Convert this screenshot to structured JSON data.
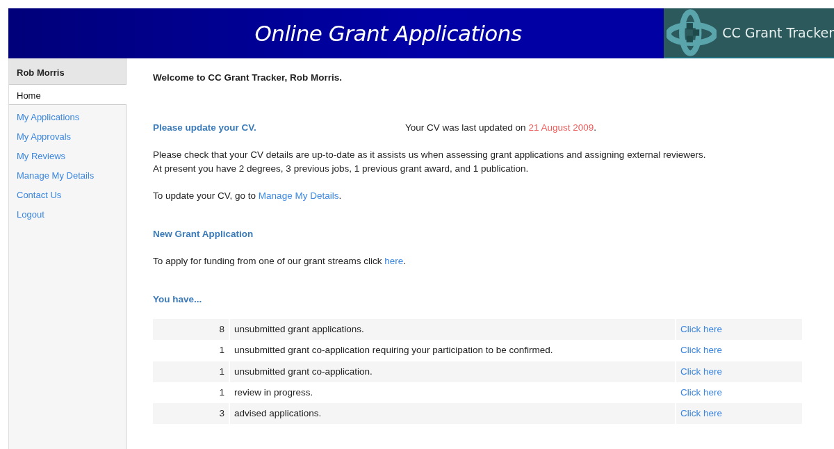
{
  "header": {
    "title": "Online Grant Applications",
    "brand": "CC Grant Tracker"
  },
  "sidebar": {
    "user": "Rob Morris",
    "items": [
      {
        "label": "Home",
        "selected": true
      },
      {
        "label": "My Applications",
        "selected": false
      },
      {
        "label": "My Approvals",
        "selected": false
      },
      {
        "label": "My Reviews",
        "selected": false
      },
      {
        "label": "Manage My Details",
        "selected": false
      },
      {
        "label": "Contact Us",
        "selected": false
      },
      {
        "label": "Logout",
        "selected": false
      }
    ]
  },
  "welcome": "Welcome to CC Grant Tracker, Rob Morris.",
  "cv": {
    "heading": "Please update your CV.",
    "last_updated": [
      {
        "kind": "plain",
        "text": "Your CV was last updated on "
      },
      {
        "kind": "date",
        "text": "21 August 2009"
      },
      {
        "kind": "plain",
        "text": "."
      }
    ],
    "paragraphs": [
      [
        {
          "kind": "plain",
          "text": "Please check that your CV details are up-to-date as it assists us when assessing grant applications and assigning external reviewers."
        }
      ],
      [
        {
          "kind": "plain",
          "text": "At present you have 2 degrees, 3 previous jobs, 1 previous grant award, and 1 publication."
        }
      ],
      [
        {
          "kind": "plain",
          "text": "To update your CV, go to "
        },
        {
          "kind": "link",
          "text": "Manage My Details"
        },
        {
          "kind": "plain",
          "text": "."
        }
      ]
    ]
  },
  "new_application": {
    "heading": "New Grant Application",
    "paragraphs": [
      [
        {
          "kind": "plain",
          "text": "To apply for funding from one of our grant streams click "
        },
        {
          "kind": "link",
          "text": "here"
        },
        {
          "kind": "plain",
          "text": "."
        }
      ]
    ]
  },
  "summary": {
    "heading": "You have...",
    "rows": [
      {
        "count": "8",
        "text": "unsubmitted grant applications.",
        "link": "Click here"
      },
      {
        "count": "1",
        "text": "unsubmitted grant co-application requiring your participation to be confirmed.",
        "link": "Click here"
      },
      {
        "count": "1",
        "text": "unsubmitted grant co-application.",
        "link": "Click here"
      },
      {
        "count": "1",
        "text": "review in progress.",
        "link": "Click here"
      },
      {
        "count": "3",
        "text": "advised applications.",
        "link": "Click here"
      }
    ]
  }
}
